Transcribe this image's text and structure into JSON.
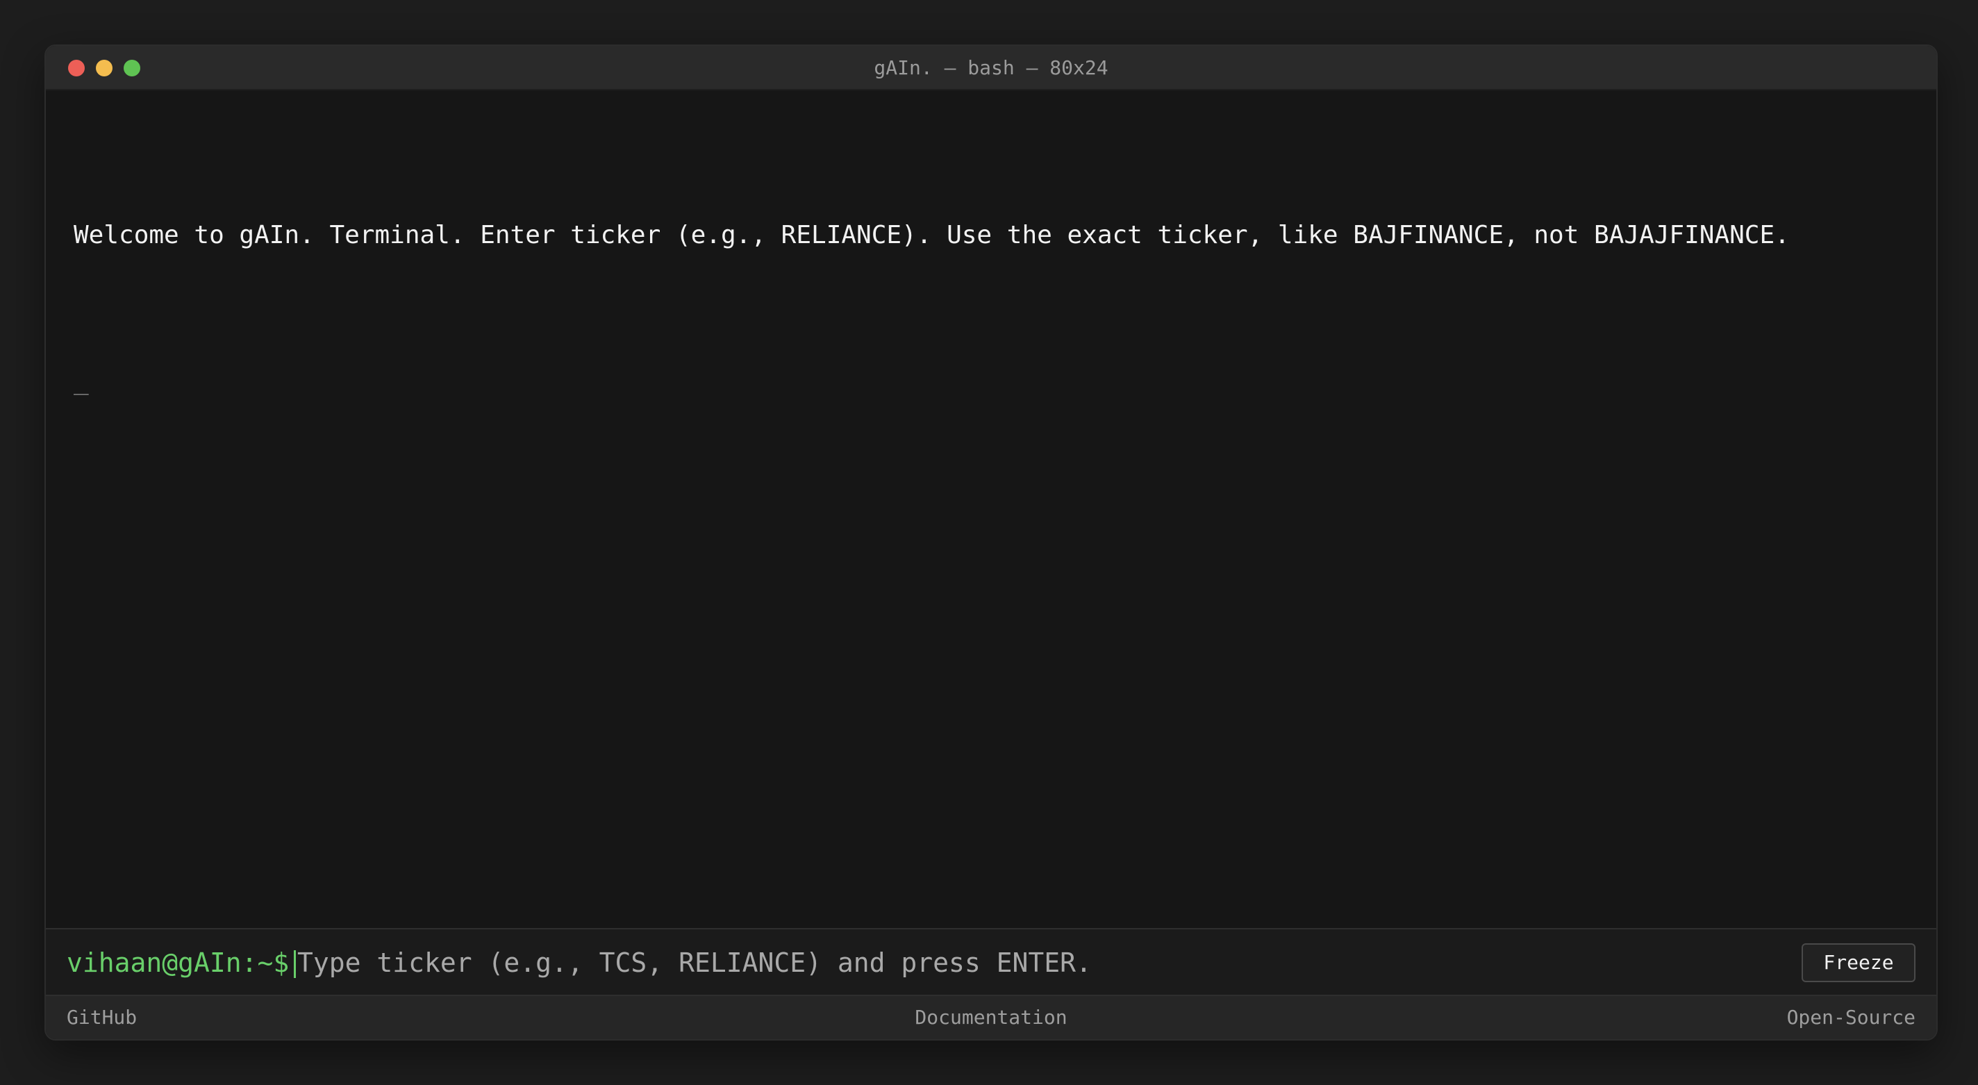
{
  "window": {
    "title": "gAIn. — bash — 80x24"
  },
  "terminal": {
    "welcome_line": "Welcome to gAIn. Terminal. Enter ticker (e.g., RELIANCE). Use the exact ticker, like BAJFINANCE, not BAJAJFINANCE.",
    "cursor_glyph": "_"
  },
  "input_bar": {
    "prompt": "vihaan@gAIn:~$",
    "value": "",
    "placeholder": "Type ticker (e.g., TCS, RELIANCE) and press ENTER.",
    "freeze_label": "Freeze"
  },
  "footer": {
    "github": "GitHub",
    "documentation": "Documentation",
    "open_source": "Open-Source"
  },
  "colors": {
    "prompt": "#69cf6a",
    "close": "#ed5f57",
    "minimize": "#f4bd4f",
    "zoom": "#5fc353",
    "background": "#161616"
  }
}
